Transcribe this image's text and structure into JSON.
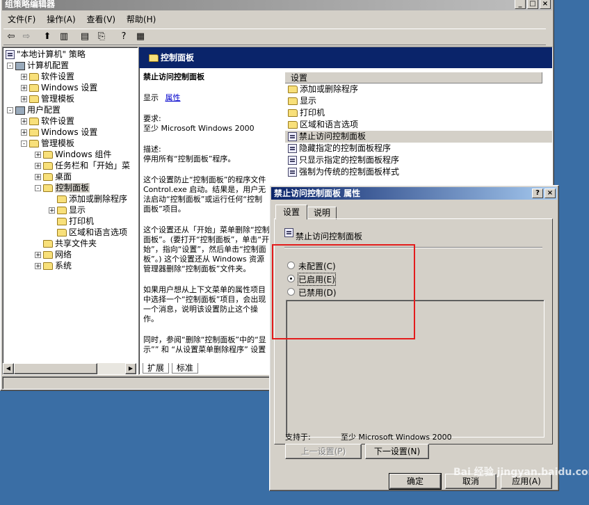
{
  "main_window": {
    "title": "组策略编辑器",
    "menu": [
      "文件(F)",
      "操作(A)",
      "查看(V)",
      "帮助(H)"
    ],
    "tree": {
      "root": "\"本地计算机\" 策略",
      "computer_config": "计算机配置",
      "cc_software": "软件设置",
      "cc_windows": "Windows 设置",
      "cc_admin": "管理模板",
      "user_config": "用户配置",
      "uc_software": "软件设置",
      "uc_windows": "Windows 设置",
      "uc_admin": "管理模板",
      "windows_components": "Windows 组件",
      "taskbar": "任务栏和「开始」菜",
      "desktop": "桌面",
      "control_panel": "控制面板",
      "add_remove": "添加或删除程序",
      "display": "显示",
      "printers": "打印机",
      "regional": "区域和语言选项",
      "shared_folders": "共享文件夹",
      "network": "网络",
      "system": "系统"
    },
    "right_header": "控制面板",
    "description": {
      "title": "禁止访问控制面板",
      "show_label": "显示",
      "properties_link": "属性",
      "requirements_label": "要求:",
      "requirements_value": "至少 Microsoft Windows 2000",
      "desc_label": "描述:",
      "desc_text": "停用所有“控制面板”程序。",
      "para1": "这个设置防止“控制面板”的程序文件 Control.exe 启动。结果是，用户无法启动“控制面板”或运行任何“控制面板”项目。",
      "para2": "这个设置还从「开始」菜单删除“控制面板”。(要打开“控制面板”，单击“开始”，指向“设置”，然后单击“控制面板”。) 这个设置还从 Windows 资源管理器删除“控制面板”文件夹。",
      "para3": "如果用户想从上下文菜单的属性项目中选择一个“控制面板”项目，会出现一个消息，说明该设置防止这个操作。",
      "para4": "同时，参阅“删除“控制面板”中的“显示”” 和 “从设置菜单删除程序” 设置"
    },
    "list_header": "设置",
    "list_items": [
      "添加或删除程序",
      "显示",
      "打印机",
      "区域和语言选项",
      "禁止访问控制面板",
      "隐藏指定的控制面板程序",
      "只显示指定的控制面板程序",
      "强制为传统的控制面板样式"
    ],
    "tabs": [
      "扩展",
      "标准"
    ]
  },
  "dialog": {
    "title": "禁止访问控制面板 属性",
    "help_btn": "?",
    "close_btn": "×",
    "tabs": [
      "设置",
      "说明"
    ],
    "policy_name": "禁止访问控制面板",
    "options": {
      "not_configured": "未配置(C)",
      "enabled": "已启用(E)",
      "disabled": "已禁用(D)"
    },
    "selected_option": "enabled",
    "supported_label": "支持于:",
    "supported_value": "至少 Microsoft Windows 2000",
    "prev_setting": "上一设置(P)",
    "next_setting": "下一设置(N)",
    "ok": "确定",
    "cancel": "取消",
    "apply": "应用(A)"
  },
  "watermark": "Bai 经验 jingyan.baidu.com",
  "colors": {
    "desktop": "#3a6ea5",
    "titlebar": "#0a246a",
    "highlight": "#e31c1c"
  }
}
